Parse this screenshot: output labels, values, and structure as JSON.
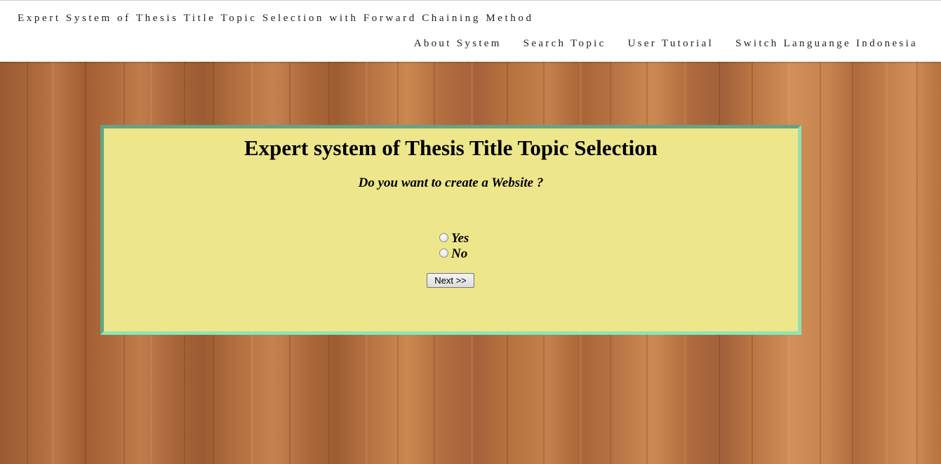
{
  "header": {
    "brand": "Expert System of Thesis Title Topic Selection with Forward Chaining Method",
    "nav": [
      {
        "label": "About System"
      },
      {
        "label": "Search Topic"
      },
      {
        "label": "User Tutorial"
      },
      {
        "label": "Switch Languange Indonesia"
      }
    ]
  },
  "panel": {
    "title": "Expert system of Thesis Title Topic Selection",
    "question": "Do you want to create a Website ?",
    "options": [
      {
        "label": "Yes",
        "selected": false
      },
      {
        "label": "No",
        "selected": false
      }
    ],
    "next_label": "Next >>"
  },
  "colors": {
    "panel_bg": "#eee68b",
    "panel_border_dark": "#5fa58a",
    "panel_border_light": "#8fe3b8",
    "header_bg": "#ffffff",
    "wood": "#b06c3c"
  }
}
